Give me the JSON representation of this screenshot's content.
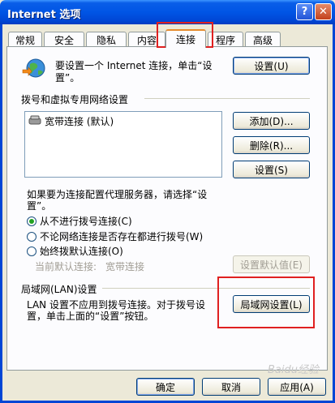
{
  "window": {
    "title": "Internet 选项",
    "help": "?",
    "close": "✕"
  },
  "tabs": [
    "常规",
    "安全",
    "隐私",
    "内容",
    "连接",
    "程序",
    "高级"
  ],
  "setup": {
    "text_line1": "要设置一个 Internet 连接，单击“设",
    "text_line2": "置”。",
    "button": "设置(U)"
  },
  "dialup": {
    "group_label": "拨号和虚拟专用网络设置",
    "list_items": [
      "宽带连接 (默认)"
    ],
    "add_button": "添加(D)...",
    "remove_button": "删除(R)...",
    "settings_button": "设置(S)"
  },
  "proxy": {
    "text_line1": "如果要为连接配置代理服务器，请选择“设",
    "text_line2": "置”。",
    "options": [
      "从不进行拨号连接(C)",
      "不论网络连接是否存在都进行拨号(W)",
      "始终拨默认连接(O)"
    ],
    "selected_index": 0,
    "current_default_label": "当前默认连接:",
    "current_default_value": "宽带连接",
    "set_default_button": "设置默认值(E)"
  },
  "lan": {
    "group_label": "局域网(LAN)设置",
    "text_line1": "LAN 设置不应用到拨号连接。对于拨号设",
    "text_line2": "置，单击上面的“设置”按钮。",
    "button": "局域网设置(L)"
  },
  "footer": {
    "ok": "确定",
    "cancel": "取消",
    "apply": "应用(A)"
  },
  "watermark": "Baidu经验",
  "colors": {
    "titlebar": "#0055e5",
    "highlight": "#e02020",
    "radio_dot": "#21a121"
  }
}
